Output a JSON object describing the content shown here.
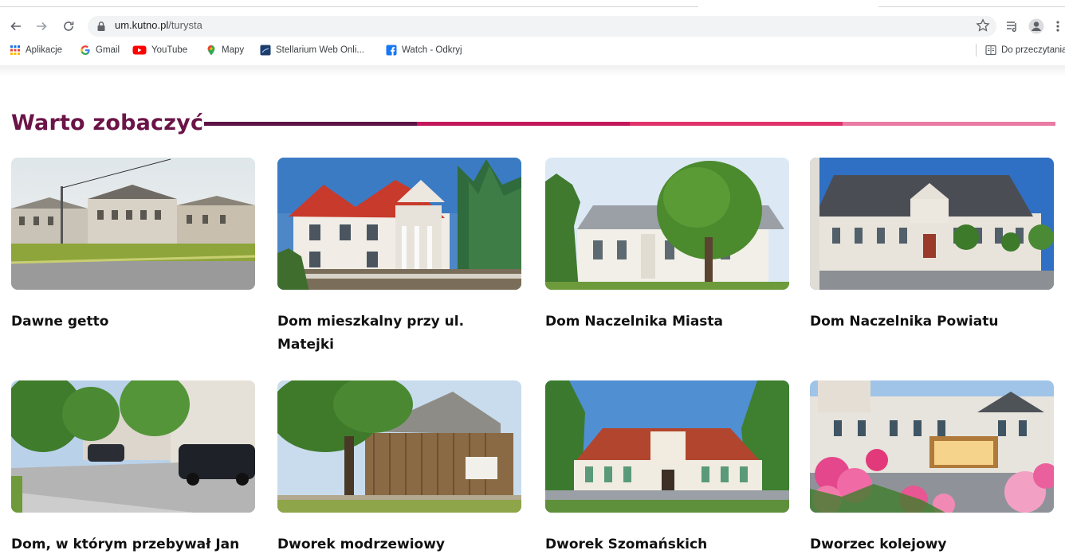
{
  "browser": {
    "url_host": "um.kutno.pl",
    "url_path": "/turysta",
    "bookmarks": [
      {
        "label": "Aplikacje",
        "icon": "apps-grid-icon"
      },
      {
        "label": "Gmail",
        "icon": "google-g-icon"
      },
      {
        "label": "YouTube",
        "icon": "youtube-icon"
      },
      {
        "label": "Mapy",
        "icon": "maps-pin-icon"
      },
      {
        "label": "Stellarium Web Onli...",
        "icon": "stellarium-icon"
      },
      {
        "label": "Watch - Odkryj",
        "icon": "facebook-icon"
      }
    ],
    "reading_list": "Do przeczytania"
  },
  "page": {
    "section_title": "Warto zobaczyć",
    "title_line_colors": [
      "#5e1245",
      "#c2185b",
      "#e0336b",
      "#e97aa3"
    ],
    "cards": [
      {
        "title": "Dawne getto",
        "photo": "ghetto-street-photo"
      },
      {
        "title": "Dom mieszkalny przy ul. Matejki",
        "photo": "matejki-house-photo"
      },
      {
        "title": "Dom Naczelnika Miasta",
        "photo": "city-mayor-house-photo"
      },
      {
        "title": "Dom Naczelnika Powiatu",
        "photo": "district-head-house-photo"
      },
      {
        "title": "Dom, w którym przebywał Jan",
        "photo": "street-with-cars-photo"
      },
      {
        "title": "Dworek modrzewiowy",
        "photo": "larch-manor-photo"
      },
      {
        "title": "Dworek Szomańskich",
        "photo": "szomanski-manor-photo"
      },
      {
        "title": "Dworzec kolejowy",
        "photo": "railway-station-photo"
      }
    ]
  }
}
